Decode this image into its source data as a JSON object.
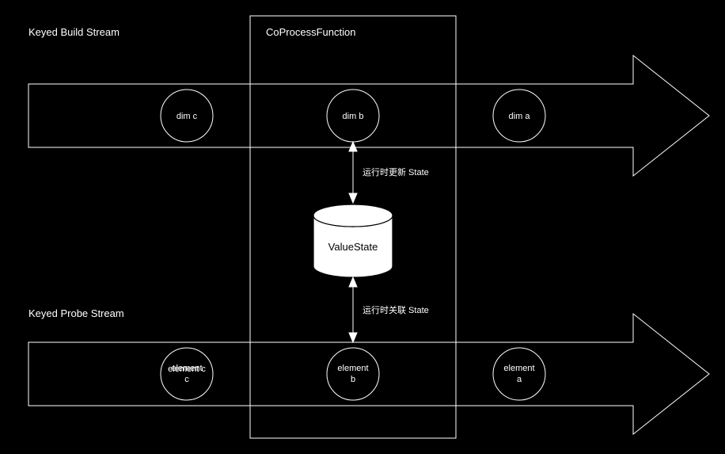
{
  "labels": {
    "buildStream": "Keyed Build Stream",
    "probeStream": "Keyed Probe Stream",
    "coprocess": "CoProcessFunction",
    "valueState": "ValueState",
    "updateState": "运行时更新 State",
    "joinState": "运行时关联 State"
  },
  "buildNodes": {
    "c": "dim c",
    "b": "dim b",
    "a": "dim a"
  },
  "probeNodes": {
    "c": "element c",
    "b": "element b",
    "a": "element a"
  }
}
